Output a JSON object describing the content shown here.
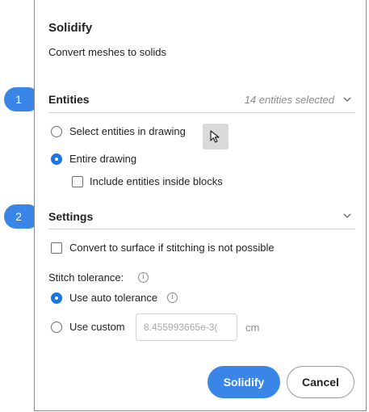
{
  "dialog": {
    "title": "Solidify",
    "subtitle": "Convert meshes to solids"
  },
  "callouts": [
    "1",
    "2"
  ],
  "entities": {
    "header": "Entities",
    "count": "14 entities selected",
    "option_select": "Select entities in drawing",
    "option_entire": "Entire drawing",
    "include_blocks": "Include entities inside blocks",
    "selected_option": "Entire drawing"
  },
  "settings": {
    "header": "Settings",
    "convert_surface": "Convert to surface if stitching is not possible",
    "stitch_tolerance": "Stitch tolerance:",
    "use_auto": "Use auto tolerance",
    "use_custom": "Use custom",
    "custom_value": "8.455993665e-3(",
    "unit": "cm",
    "selected_option": "Use auto tolerance"
  },
  "buttons": {
    "solidify": "Solidify",
    "cancel": "Cancel"
  },
  "colors": {
    "accent": "#1976e3",
    "callout": "#3a86e6",
    "primary_button": "#3a86e6"
  }
}
